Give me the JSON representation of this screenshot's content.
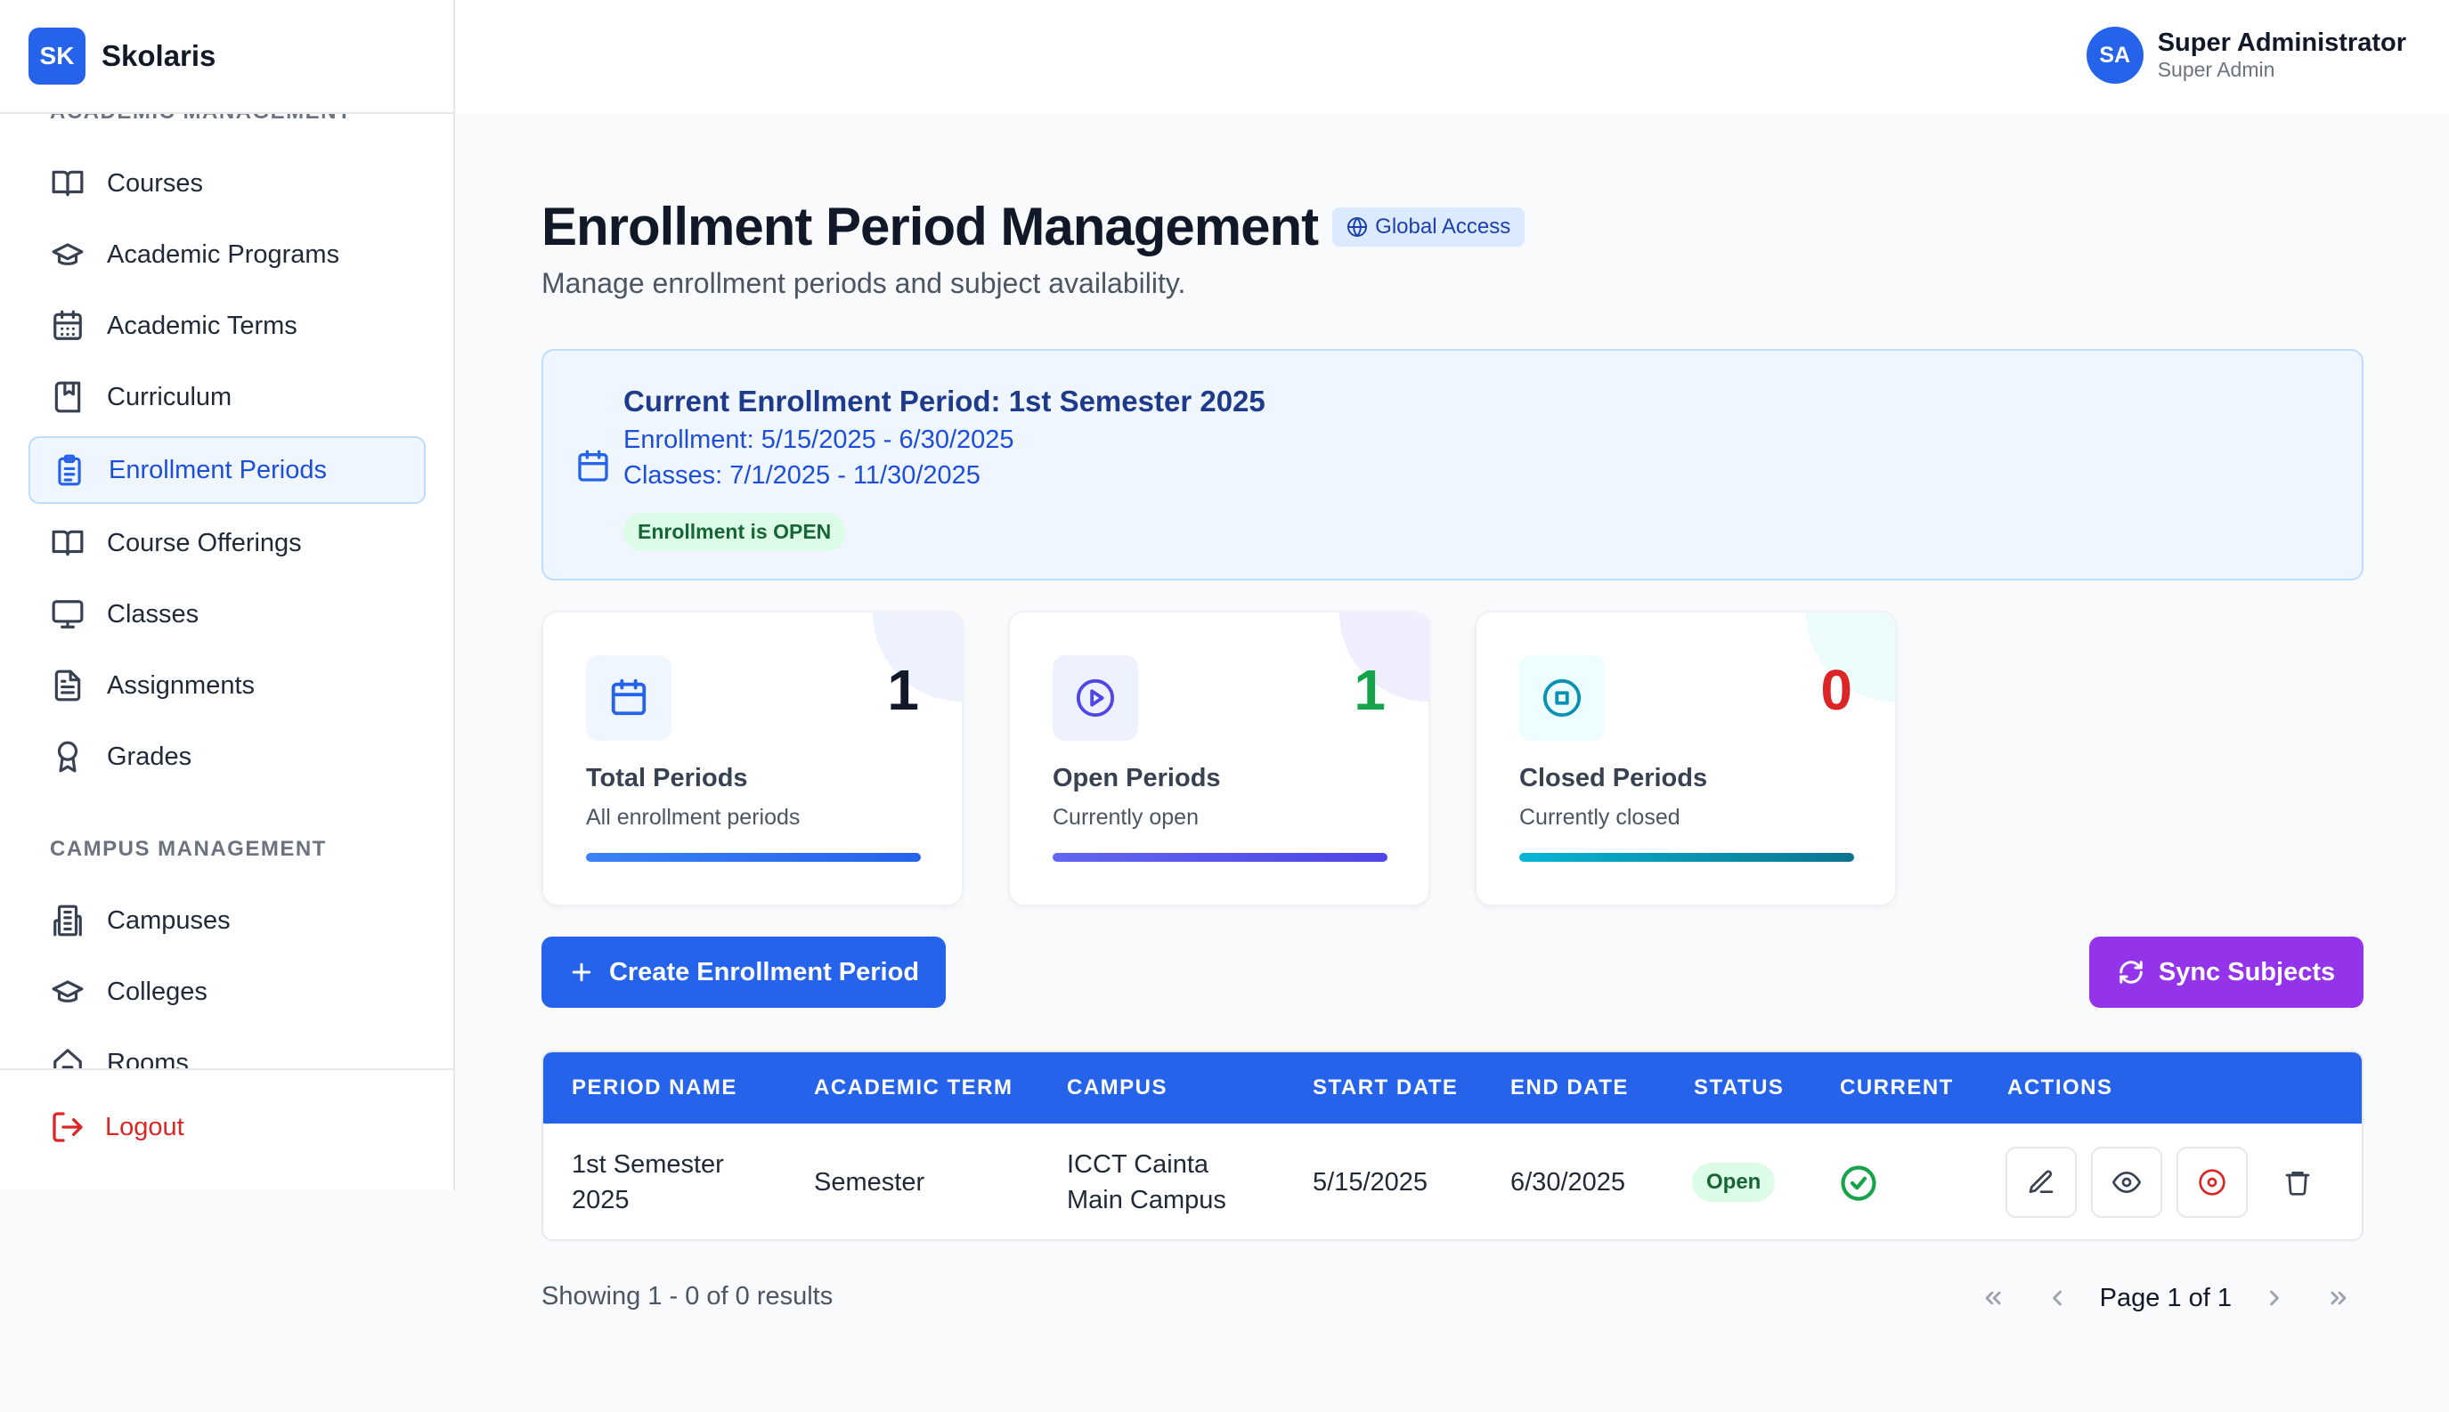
{
  "brand": {
    "logo": "SK",
    "name": "Skolaris"
  },
  "sidebar": {
    "sections": [
      {
        "title": "ACADEMIC MANAGEMENT"
      },
      {
        "title": "CAMPUS MANAGEMENT"
      }
    ],
    "items": [
      {
        "label": "Courses",
        "icon": "book-open-icon"
      },
      {
        "label": "Academic Programs",
        "icon": "graduation-cap-icon"
      },
      {
        "label": "Academic Terms",
        "icon": "calendar-icon"
      },
      {
        "label": "Curriculum",
        "icon": "book-marked-icon"
      },
      {
        "label": "Enrollment Periods",
        "icon": "clipboard-list-icon",
        "active": true
      },
      {
        "label": "Course Offerings",
        "icon": "book-open-icon"
      },
      {
        "label": "Classes",
        "icon": "monitor-icon"
      },
      {
        "label": "Assignments",
        "icon": "file-text-icon"
      },
      {
        "label": "Grades",
        "icon": "award-icon"
      },
      {
        "label": "Campuses",
        "icon": "building-icon"
      },
      {
        "label": "Colleges",
        "icon": "graduation-cap-icon"
      },
      {
        "label": "Rooms",
        "icon": "home-icon"
      }
    ],
    "logout": "Logout"
  },
  "user": {
    "initials": "SA",
    "name": "Super Administrator",
    "role": "Super Admin"
  },
  "page": {
    "title": "Enrollment Period Management",
    "badge": "Global Access",
    "subtitle": "Manage enrollment periods and subject availability."
  },
  "current": {
    "title": "Current Enrollment Period: 1st Semester 2025",
    "enrollment": "Enrollment: 5/15/2025 - 6/30/2025",
    "classes": "Classes: 7/1/2025 - 11/30/2025",
    "status": "Enrollment is OPEN"
  },
  "stats": [
    {
      "label": "Total Periods",
      "desc": "All enrollment periods",
      "value": "1",
      "color": "#111827"
    },
    {
      "label": "Open Periods",
      "desc": "Currently open",
      "value": "1",
      "color": "#16a34a"
    },
    {
      "label": "Closed Periods",
      "desc": "Currently closed",
      "value": "0",
      "color": "#dc2626"
    }
  ],
  "buttons": {
    "create": "Create Enrollment Period",
    "sync": "Sync Subjects"
  },
  "table": {
    "headers": [
      "PERIOD NAME",
      "ACADEMIC TERM",
      "CAMPUS",
      "START DATE",
      "END DATE",
      "STATUS",
      "CURRENT",
      "ACTIONS"
    ],
    "rows": [
      {
        "name_l1": "1st Semester",
        "name_l2": "2025",
        "term": "Semester",
        "campus_l1": "ICCT Cainta",
        "campus_l2": "Main Campus",
        "start": "5/15/2025",
        "end": "6/30/2025",
        "status": "Open"
      }
    ]
  },
  "footer": {
    "showing": "Showing 1 - 0 of 0 results",
    "page": "Page 1 of 1"
  },
  "colors": {
    "primary": "#2563eb",
    "sync": "#9333ea",
    "success": "#16a34a",
    "danger": "#dc2626"
  }
}
